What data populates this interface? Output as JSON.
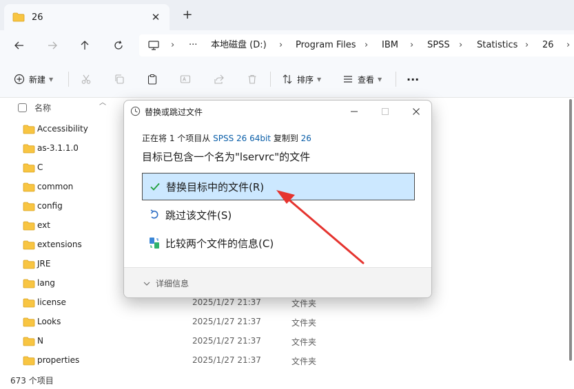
{
  "tab": {
    "title": "26",
    "close": "✕",
    "add": "+"
  },
  "address": {
    "more": "···",
    "crumbs": [
      "本地磁盘 (D:)",
      "Program Files",
      "IBM",
      "SPSS",
      "Statistics",
      "26"
    ],
    "separator": "›"
  },
  "toolbar": {
    "new_label": "新建",
    "sort_label": "排序",
    "view_label": "查看",
    "more_label": "···"
  },
  "list": {
    "column_name": "名称",
    "rows": [
      {
        "name": "Accessibility",
        "date": "",
        "type": ""
      },
      {
        "name": "as-3.1.1.0",
        "date": "",
        "type": ""
      },
      {
        "name": "C",
        "date": "",
        "type": ""
      },
      {
        "name": "common",
        "date": "",
        "type": ""
      },
      {
        "name": "config",
        "date": "",
        "type": ""
      },
      {
        "name": "ext",
        "date": "",
        "type": ""
      },
      {
        "name": "extensions",
        "date": "",
        "type": ""
      },
      {
        "name": "JRE",
        "date": "",
        "type": ""
      },
      {
        "name": "lang",
        "date": "",
        "type": ""
      },
      {
        "name": "license",
        "date": "2025/1/27 21:37",
        "type": "文件夹"
      },
      {
        "name": "Looks",
        "date": "2025/1/27 21:37",
        "type": "文件夹"
      },
      {
        "name": "N",
        "date": "2025/1/27 21:37",
        "type": "文件夹"
      },
      {
        "name": "properties",
        "date": "2025/1/27 21:37",
        "type": "文件夹"
      }
    ]
  },
  "status": {
    "count": "673 个项目"
  },
  "dialog": {
    "title": "替换或跳过文件",
    "line1_pre": "正在将 1 个项目从 ",
    "line1_src": "SPSS 26 64bit",
    "line1_mid": " 复制到 ",
    "line1_dst": "26",
    "line2": "目标已包含一个名为\"lservrc\"的文件",
    "options": {
      "replace": "替换目标中的文件(R)",
      "skip": "跳过该文件(S)",
      "compare": "比较两个文件的信息(C)"
    },
    "details": "详细信息"
  },
  "colors": {
    "selected_bg": "#cce8ff",
    "link": "#0a5ea8",
    "arrow": "#e5342f",
    "folder": "#f8c542",
    "check": "#1e9e3a"
  }
}
